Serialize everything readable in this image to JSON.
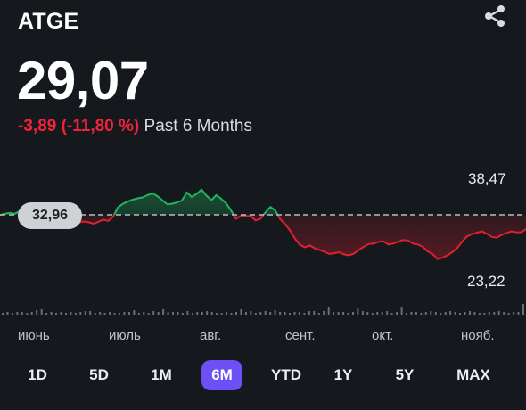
{
  "header": {
    "ticker": "ATGE",
    "price": "29,07",
    "change": "-3,89 (-11,80 %)",
    "period": "Past 6 Months"
  },
  "icons": {
    "share": "share-icon"
  },
  "colors": {
    "background": "#15181d",
    "up": "#22b45e",
    "down": "#e0202e",
    "accent": "#6d50f5"
  },
  "chart": {
    "high_label": "38,47",
    "low_label": "23,22",
    "previous_close_label": "32,96"
  },
  "chart_data": {
    "type": "line",
    "previous_close": 32.96,
    "high": 38.47,
    "low": 23.22,
    "x_tick_labels": [
      "июнь",
      "июль",
      "авг.",
      "сент.",
      "окт.",
      "нояб."
    ],
    "y": [
      32.9,
      33.2,
      33.4,
      33.2,
      33.8,
      34.5,
      34.9,
      35.0,
      34.3,
      33.0,
      32.2,
      31.1,
      30.8,
      31.3,
      31.1,
      30.9,
      31.2,
      31.5,
      31.3,
      31.0,
      31.4,
      31.9,
      31.6,
      32.5,
      34.6,
      35.4,
      35.9,
      36.3,
      36.6,
      36.8,
      37.3,
      37.7,
      37.1,
      36.2,
      35.3,
      35.4,
      35.7,
      36.1,
      37.9,
      36.9,
      37.6,
      38.5,
      37.2,
      36.2,
      37.3,
      36.5,
      35.5,
      33.9,
      32.1,
      32.7,
      32.7,
      32.7,
      31.7,
      32.1,
      33.5,
      34.7,
      33.9,
      32.0,
      30.9,
      29.5,
      27.7,
      26.3,
      25.8,
      26.2,
      25.6,
      25.2,
      24.8,
      24.3,
      24.5,
      24.7,
      24.2,
      24.0,
      24.4,
      25.2,
      25.9,
      26.5,
      26.6,
      27.0,
      27.1,
      26.4,
      26.6,
      27.0,
      27.4,
      27.3,
      26.6,
      26.4,
      25.9,
      24.9,
      24.3,
      23.2,
      23.5,
      24.0,
      24.7,
      25.6,
      27.0,
      28.2,
      28.7,
      29.0,
      29.3,
      28.8,
      28.1,
      27.9,
      28.5,
      28.9,
      29.3,
      29.1,
      29.1,
      29.8
    ],
    "volume": [
      2,
      3,
      2,
      3,
      3,
      2,
      3,
      5,
      6,
      2,
      3,
      2,
      3,
      2,
      3,
      2,
      3,
      4,
      4,
      2,
      3,
      2,
      3,
      2,
      2,
      3,
      3,
      5,
      2,
      3,
      2,
      4,
      3,
      6,
      3,
      3,
      3,
      2,
      4,
      2,
      3,
      3,
      4,
      3,
      2,
      2,
      3,
      2,
      3,
      6,
      3,
      4,
      2,
      3,
      4,
      3,
      5,
      3,
      3,
      2,
      3,
      3,
      2,
      4,
      4,
      2,
      4,
      9,
      3,
      3,
      3,
      2,
      3,
      7,
      4,
      3,
      2,
      3,
      3,
      4,
      2,
      3,
      8,
      2,
      3,
      3,
      2,
      3,
      4,
      3,
      2,
      3,
      4,
      3,
      2,
      3,
      4,
      3,
      2,
      2,
      3,
      3,
      4,
      3,
      2,
      3,
      3,
      12
    ]
  },
  "months": [
    "июнь",
    "июль",
    "авг.",
    "сент.",
    "окт.",
    "нояб."
  ],
  "ranges": [
    {
      "label": "1D",
      "active": false
    },
    {
      "label": "5D",
      "active": false
    },
    {
      "label": "1M",
      "active": false
    },
    {
      "label": "6M",
      "active": true
    },
    {
      "label": "YTD",
      "active": false
    },
    {
      "label": "1Y",
      "active": false
    },
    {
      "label": "5Y",
      "active": false
    },
    {
      "label": "MAX",
      "active": false
    }
  ]
}
